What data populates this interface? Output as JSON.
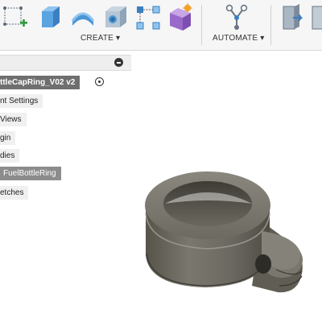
{
  "toolbar": {
    "groups": [
      {
        "label": "CREATE ▾"
      },
      {
        "label": "AUTOMATE ▾"
      }
    ],
    "icons": [
      "create-sketch-icon",
      "extrude-icon",
      "revolve-icon",
      "hole-icon",
      "pattern-icon",
      "new-component-icon",
      "automate-icon",
      "modify-icon",
      "assemble-icon"
    ]
  },
  "browser": {
    "items": [
      {
        "label": "ttleCapRing_V02 v2",
        "state": "active"
      },
      {
        "label": "nt Settings"
      },
      {
        "label": "Views"
      },
      {
        "label": "gin"
      },
      {
        "label": "dies"
      },
      {
        "label": "FuelBottleRing",
        "state": "selected"
      },
      {
        "label": "etches"
      }
    ]
  },
  "colors": {
    "toolbar_bg": "#f6f6f6",
    "active_node_bg": "#6f6f6f",
    "selected_node_bg": "#8c8c8c",
    "model_body": "#6e6c63"
  }
}
